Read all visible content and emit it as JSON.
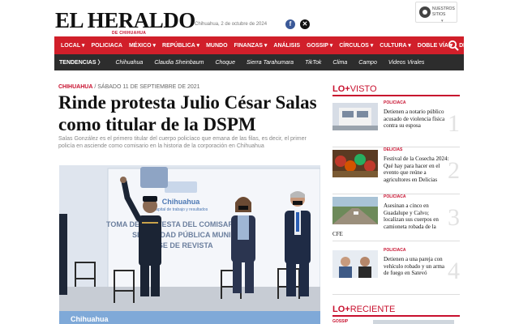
{
  "header": {
    "logo": "EL HERALDO",
    "logo_sub": "DE CHIHUAHUA",
    "date": "Chihuahua, 2 de octubre de 2024",
    "sites_label": "NUESTROS SITIOS"
  },
  "nav": {
    "items": [
      "LOCAL ▾",
      "POLICIACA",
      "MÉXICO ▾",
      "REPÚBLICA ▾",
      "MUNDO",
      "FINANZAS ▾",
      "ANÁLISIS",
      "GOSSIP ▾",
      "CÍRCULOS ▾",
      "CULTURA ▾",
      "DOBLE VÍA ▾",
      "DEPORTES ▾"
    ]
  },
  "trending": {
    "title": "TENDENCIAS  〉",
    "items": [
      "Chihuahua",
      "Claudia Sheinbaum",
      "Choque",
      "Sierra Tarahumara",
      "TikTok",
      "Clima",
      "Campo",
      "Videos Virales"
    ]
  },
  "article": {
    "section": "CHIHUAHUA",
    "date": "/ SÁBADO 11 DE SEPTIEMBRE DE 2021",
    "headline": "Rinde protesta Julio César Salas como titular de la DSPM",
    "summary": "Salas González es el primero titular del cuerpo policíaco que emana de las filas, es decir, el primer policía en asciende como comisario en la historia de la corporación en Chihuahua",
    "photo_banner_1": "Chihuahua",
    "photo_banner_2": "capital de trabajo y resultados",
    "photo_banner_3": "TOMA DE PROTESTA DEL COMISARIO",
    "photo_banner_4": "SEGURIDAD PÚBLICA MUNICIPAL",
    "photo_banner_5": "PASE DE REVISTA",
    "photo_footer": "Chihuahua"
  },
  "sidebar": {
    "mas_visto_bold": "LO+",
    "mas_visto_lite": "VISTO",
    "items": [
      {
        "category": "POLICIACA",
        "title": "Detienen a notario público acusado de violencia física contra su esposa",
        "number": "1",
        "tail": ""
      },
      {
        "category": "DELICIAS",
        "title": "Festival de la Cosecha 2024: Qué hay para hacer en el evento que reúne a agricultores en Delicias",
        "number": "2",
        "tail": ""
      },
      {
        "category": "POLICIACA",
        "title": "Asesinan a cinco en Guadalupe y Calvo; localizan sus cuerpos en camioneta robada de la",
        "number": "3",
        "tail": "CFE"
      },
      {
        "category": "POLICIACA",
        "title": "Detienen a una pareja con vehículo robado y un arma de fuego en Satevó",
        "number": "4",
        "tail": ""
      }
    ],
    "reciente_bold": "LO+",
    "reciente_lite": "RECIENTE",
    "reciente_category": "GOSSIP"
  },
  "colors": {
    "brand_red": "#d11f2a",
    "trend_bar": "#2d2d2d"
  }
}
